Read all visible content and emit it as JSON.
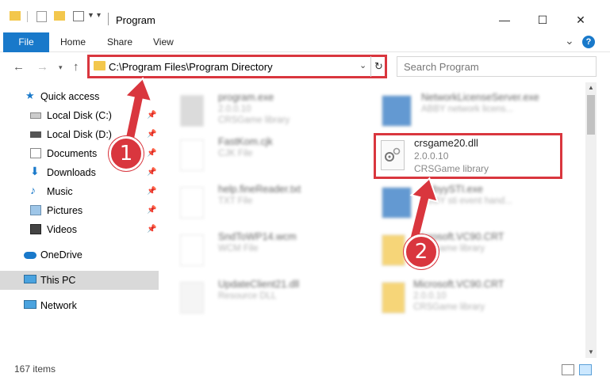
{
  "window": {
    "title": "Program",
    "minimize": "—",
    "maximize": "☐",
    "close": "✕"
  },
  "ribbon": {
    "tabs": [
      "File",
      "Home",
      "Share",
      "View"
    ],
    "expand_icon": "⌄",
    "help_icon": "?"
  },
  "address": {
    "path": "C:\\Program Files\\Program Directory",
    "search_placeholder": "Search Program"
  },
  "sidebar": {
    "items": [
      {
        "label": "Quick access",
        "icon": "star-icon"
      },
      {
        "label": "Local Disk (C:)",
        "icon": "drive-icon",
        "pinned": true
      },
      {
        "label": "Local Disk (D:)",
        "icon": "drive-icon",
        "pinned": true
      },
      {
        "label": "Documents",
        "icon": "documents-icon",
        "pinned": true
      },
      {
        "label": "Downloads",
        "icon": "download-icon",
        "pinned": true
      },
      {
        "label": "Music",
        "icon": "music-icon",
        "pinned": true
      },
      {
        "label": "Pictures",
        "icon": "pictures-icon",
        "pinned": true
      },
      {
        "label": "Videos",
        "icon": "videos-icon",
        "pinned": true
      },
      {
        "label": "OneDrive",
        "icon": "cloud-icon"
      },
      {
        "label": "This PC",
        "icon": "pc-icon",
        "selected": true
      },
      {
        "label": "Network",
        "icon": "network-icon"
      }
    ]
  },
  "files_left": [
    {
      "name": "program.exe",
      "meta": "2.0.0.10",
      "meta2": "CRSGame library"
    },
    {
      "name": "FastKom.cjk",
      "meta": "CJK File"
    },
    {
      "name": "help.fineReader.txt",
      "meta": "TXT File"
    },
    {
      "name": "SndToWP14.wcm",
      "meta": "WCM File"
    },
    {
      "name": "UpdateClient21.dll",
      "meta": "Resource DLL"
    }
  ],
  "files_right": [
    {
      "name": "NetworkLicenseServer.exe",
      "meta": "ABBY network licens..."
    },
    {
      "name": "AbbyySTI.exe",
      "meta": "ABBY sti event hand..."
    },
    {
      "name": "Microsoft.VC90.CRT",
      "meta": "CRSGame library"
    },
    {
      "name": "Microsoft.VC90.CRT",
      "meta": "2.0.0.10",
      "meta2": "CRSGame library"
    }
  ],
  "highlighted_file": {
    "name": "crsgame20.dll",
    "version": "2.0.0.10",
    "description": "CRSGame library"
  },
  "status": {
    "items_count": "167 items"
  },
  "callouts": [
    "1",
    "2"
  ],
  "colors": {
    "accent": "#1979ca",
    "highlight": "#d9363e",
    "folder": "#f3c74c"
  }
}
